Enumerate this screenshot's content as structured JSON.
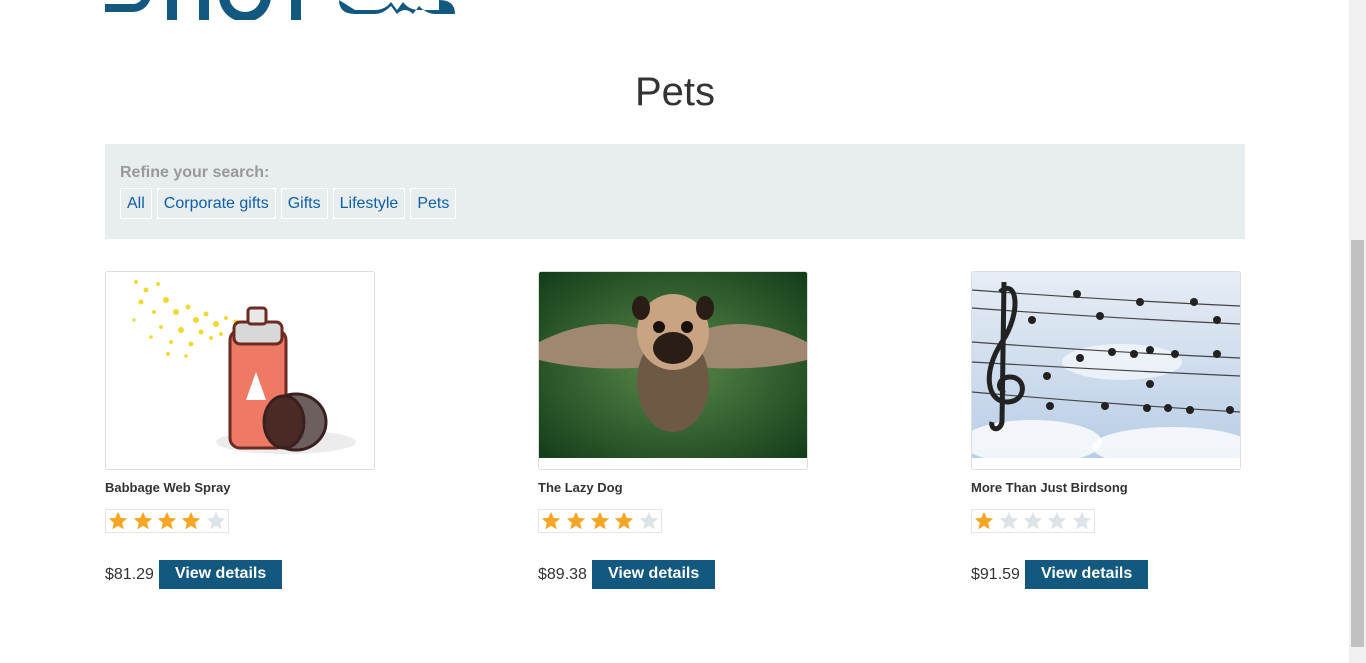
{
  "header": {
    "logo_text": "SHOP"
  },
  "page": {
    "title": "Pets"
  },
  "filters": {
    "label": "Refine your search:",
    "options": [
      "All",
      "Corporate gifts",
      "Gifts",
      "Lifestyle",
      "Pets"
    ]
  },
  "products": [
    {
      "name": "Babbage Web Spray",
      "rating": 4,
      "rating_max": 5,
      "price": "$81.29",
      "button": "View details",
      "image": "spray-can-image"
    },
    {
      "name": "The Lazy Dog",
      "rating": 4,
      "rating_max": 5,
      "price": "$89.38",
      "button": "View details",
      "image": "winged-pug-image"
    },
    {
      "name": "More Than Just Birdsong",
      "rating": 1,
      "rating_max": 5,
      "price": "$91.59",
      "button": "View details",
      "image": "birds-on-wires-image"
    }
  ],
  "colors": {
    "accent": "#13587f",
    "link": "#0e5fa8",
    "star_on": "#f5a623",
    "star_off": "#dde3e6",
    "filter_bg": "#e8edf0"
  }
}
